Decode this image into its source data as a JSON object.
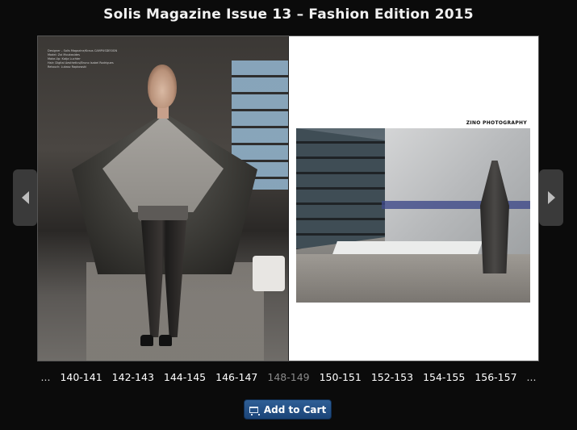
{
  "header": {
    "title": "Solis Magazine Issue 13 – Fashion Edition 2015"
  },
  "viewer": {
    "left_page": {
      "credits": [
        "Designer – Solis Magazine/Kraus CAMPUSDESIGN",
        "Model: Zoi Moukasides",
        "Make-Up: Katja Luchter",
        "Hair: Digital Aesthetics/Bruno Isabel Rodrigues",
        "Retouch: Lukasz Rapkowski"
      ]
    },
    "right_page": {
      "photo_credit": "ZINO PHOTOGRAPHY"
    }
  },
  "navigation": {
    "prev_icon": "chevron-left-icon",
    "next_icon": "chevron-right-icon"
  },
  "pagination": {
    "leading_ellipsis": "...",
    "pages": [
      {
        "label": "140-141",
        "current": false
      },
      {
        "label": "142-143",
        "current": false
      },
      {
        "label": "144-145",
        "current": false
      },
      {
        "label": "146-147",
        "current": false
      },
      {
        "label": "148-149",
        "current": true
      },
      {
        "label": "150-151",
        "current": false
      },
      {
        "label": "152-153",
        "current": false
      },
      {
        "label": "154-155",
        "current": false
      },
      {
        "label": "156-157",
        "current": false
      }
    ],
    "trailing_ellipsis": "..."
  },
  "cart": {
    "label": "Add to Cart",
    "icon": "cart-icon",
    "color": "#1f4b80"
  }
}
